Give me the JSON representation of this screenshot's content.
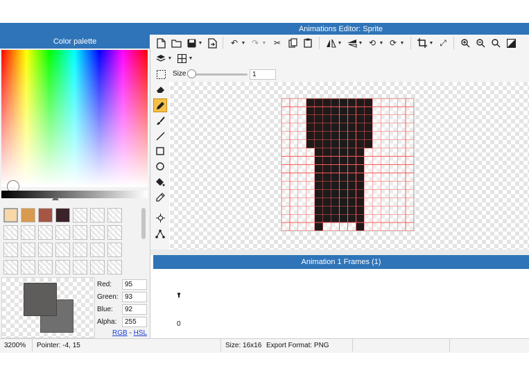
{
  "palette": {
    "title": "Color palette",
    "swatches": [
      "#f8d7a9",
      "#d89a4f",
      "#a55645",
      "#3b2329"
    ],
    "empty_swatch_count": 24,
    "primary_color": "#5f5d5c",
    "secondary_color": "#6f6f6f",
    "channels": [
      {
        "label": "Red:",
        "value": "95"
      },
      {
        "label": "Green:",
        "value": "93"
      },
      {
        "label": "Blue:",
        "value": "92"
      },
      {
        "label": "Alpha:",
        "value": "255"
      }
    ],
    "mode_rgb": "RGB",
    "mode_separator": "-",
    "mode_hsl": "HSL"
  },
  "editor": {
    "title": "Animations Editor: Sprite",
    "size_label": "Size",
    "size_value": "1",
    "toolbar_icons": [
      "new-file-icon",
      "open-folder-icon",
      "save-icon",
      "export-icon",
      "undo-icon",
      "redo-icon",
      "cut-icon",
      "copy-icon",
      "paste-icon",
      "flip-horizontal-icon",
      "flip-vertical-icon",
      "rotate-left-icon",
      "rotate-right-icon",
      "crop-icon",
      "resize-icon",
      "zoom-in-icon",
      "zoom-out-icon",
      "zoom-fit-icon",
      "invert-icon",
      "layers-icon",
      "grid-icon"
    ],
    "tools": [
      "select-icon",
      "eraser-icon",
      "pencil-icon",
      "brush-icon",
      "line-icon",
      "rectangle-icon",
      "ellipse-icon",
      "fill-bucket-icon",
      "eyedropper-icon",
      "pivot-icon",
      "bone-icon"
    ],
    "active_tool": "pencil-icon",
    "accent": "#f5c04a",
    "sprite_color": "#1e1a1a",
    "grid_color": "#ff5a5a"
  },
  "frames": {
    "title": "Animation 1 Frames (1)",
    "frame_index": "0"
  },
  "status": {
    "zoom": "3200%",
    "pointer": "Pointer: -4, 15",
    "size": "Size: 16x16",
    "format": "Export Format: PNG"
  }
}
